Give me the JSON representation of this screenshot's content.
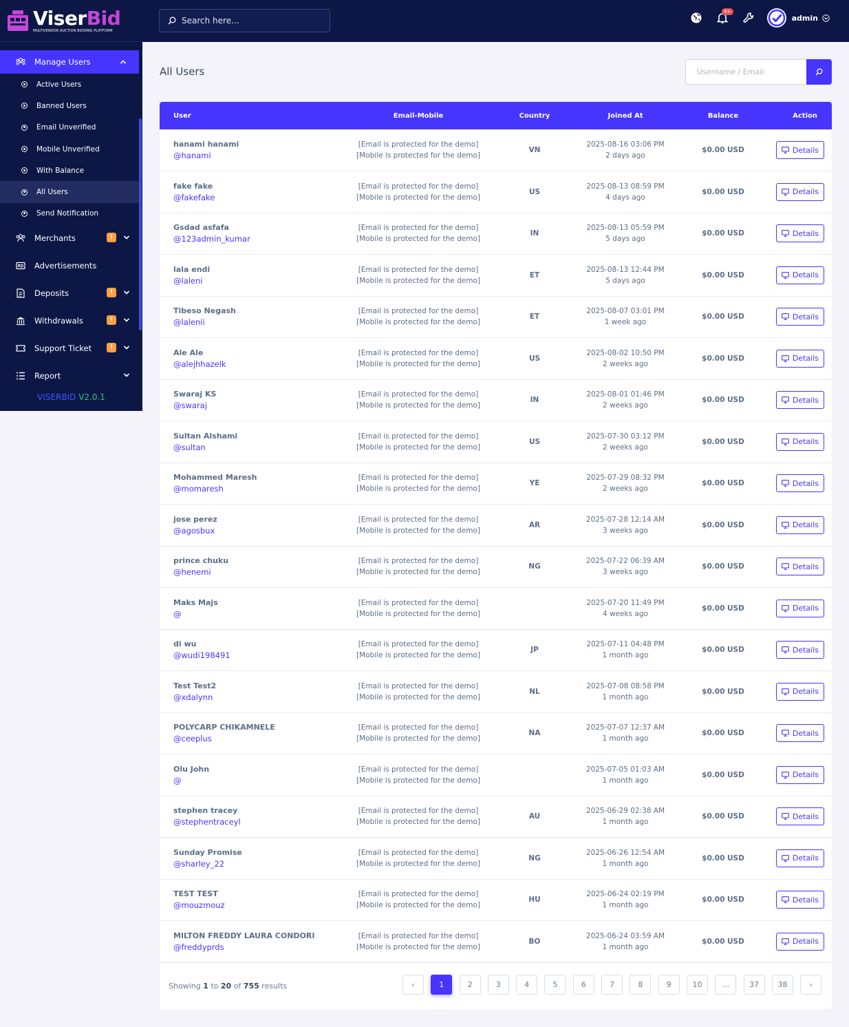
{
  "brand": {
    "name_part1": "Viser",
    "name_part2": "Bid",
    "tagline": "MULTIVENDOR AUCTION BIDDING PLATFORM"
  },
  "sidebar": {
    "manage_users": "Manage Users",
    "sub_items": [
      "Active Users",
      "Banned Users",
      "Email Unverified",
      "Mobile Unverified",
      "With Balance",
      "All Users",
      "Send Notification"
    ],
    "merchants": "Merchants",
    "advertisements": "Advertisements",
    "deposits": "Deposits",
    "withdrawals": "Withdrawals",
    "support_ticket": "Support Ticket",
    "report": "Report",
    "badge": "!",
    "version_name": "VISERBID",
    "version_num": "V2.0.1"
  },
  "topbar": {
    "search_placeholder": "Search here...",
    "notif_count": "9+",
    "admin_name": "admin"
  },
  "page": {
    "title": "All Users",
    "filter_placeholder": "Username / Email"
  },
  "table": {
    "headers": [
      "User",
      "Email-Mobile",
      "Country",
      "Joined At",
      "Balance",
      "Action"
    ],
    "email_text": "[Email is protected for the demo]",
    "mobile_text": "[Mobile is protected for the demo]",
    "details_label": "Details",
    "rows": [
      {
        "name": "hanami hanami",
        "username": "@hanami",
        "country": "VN",
        "date": "2025-08-16 03:06 PM",
        "ago": "2 days ago",
        "balance": "$0.00 USD"
      },
      {
        "name": "fake fake",
        "username": "@fakefake",
        "country": "US",
        "date": "2025-08-13 08:59 PM",
        "ago": "4 days ago",
        "balance": "$0.00 USD"
      },
      {
        "name": "Gsdad asfafa",
        "username": "@123admin_kumar",
        "country": "IN",
        "date": "2025-08-13 05:59 PM",
        "ago": "5 days ago",
        "balance": "$0.00 USD"
      },
      {
        "name": "lala endi",
        "username": "@laleni",
        "country": "ET",
        "date": "2025-08-13 12:44 PM",
        "ago": "5 days ago",
        "balance": "$0.00 USD"
      },
      {
        "name": "Tibeso Negash",
        "username": "@lalenii",
        "country": "ET",
        "date": "2025-08-07 03:01 PM",
        "ago": "1 week ago",
        "balance": "$0.00 USD"
      },
      {
        "name": "Ale Ale",
        "username": "@alejhhazelk",
        "country": "US",
        "date": "2025-08-02 10:50 PM",
        "ago": "2 weeks ago",
        "balance": "$0.00 USD"
      },
      {
        "name": "Swaraj KS",
        "username": "@swaraj",
        "country": "IN",
        "date": "2025-08-01 01:46 PM",
        "ago": "2 weeks ago",
        "balance": "$0.00 USD"
      },
      {
        "name": "Sultan Alshami",
        "username": "@sultan",
        "country": "US",
        "date": "2025-07-30 03:12 PM",
        "ago": "2 weeks ago",
        "balance": "$0.00 USD"
      },
      {
        "name": "Mohammed Maresh",
        "username": "@momaresh",
        "country": "YE",
        "date": "2025-07-29 08:32 PM",
        "ago": "2 weeks ago",
        "balance": "$0.00 USD"
      },
      {
        "name": "jose perez",
        "username": "@agosbux",
        "country": "AR",
        "date": "2025-07-28 12:14 AM",
        "ago": "3 weeks ago",
        "balance": "$0.00 USD"
      },
      {
        "name": "prince chuku",
        "username": "@henemi",
        "country": "NG",
        "date": "2025-07-22 06:39 AM",
        "ago": "3 weeks ago",
        "balance": "$0.00 USD"
      },
      {
        "name": "Maks Majs",
        "username": "@",
        "country": "",
        "date": "2025-07-20 11:49 PM",
        "ago": "4 weeks ago",
        "balance": "$0.00 USD"
      },
      {
        "name": "di wu",
        "username": "@wudi198491",
        "country": "JP",
        "date": "2025-07-11 04:48 PM",
        "ago": "1 month ago",
        "balance": "$0.00 USD"
      },
      {
        "name": "Test Test2",
        "username": "@xdalynn",
        "country": "NL",
        "date": "2025-07-08 08:58 PM",
        "ago": "1 month ago",
        "balance": "$0.00 USD"
      },
      {
        "name": "POLYCARP CHIKAMNELE",
        "username": "@ceeplus",
        "country": "NA",
        "date": "2025-07-07 12:37 AM",
        "ago": "1 month ago",
        "balance": "$0.00 USD"
      },
      {
        "name": "Olu John",
        "username": "@",
        "country": "",
        "date": "2025-07-05 01:03 AM",
        "ago": "1 month ago",
        "balance": "$0.00 USD"
      },
      {
        "name": "stephen tracey",
        "username": "@stephentraceyl",
        "country": "AU",
        "date": "2025-06-29 02:38 AM",
        "ago": "1 month ago",
        "balance": "$0.00 USD"
      },
      {
        "name": "Sunday Promise",
        "username": "@sharley_22",
        "country": "NG",
        "date": "2025-06-26 12:54 AM",
        "ago": "1 month ago",
        "balance": "$0.00 USD"
      },
      {
        "name": "TEST TEST",
        "username": "@mouzmouz",
        "country": "HU",
        "date": "2025-06-24 02:19 PM",
        "ago": "1 month ago",
        "balance": "$0.00 USD"
      },
      {
        "name": "MILTON FREDDY LAURA CONDORI",
        "username": "@freddyprds",
        "country": "BO",
        "date": "2025-06-24 03:59 AM",
        "ago": "1 month ago",
        "balance": "$0.00 USD"
      }
    ]
  },
  "pagination": {
    "showing_prefix": "Showing",
    "from": "1",
    "to_word": "to",
    "to": "20",
    "of_word": "of",
    "total": "755",
    "results_word": "results",
    "prev": "‹",
    "next": "›",
    "pages": [
      "1",
      "2",
      "3",
      "4",
      "5",
      "6",
      "7",
      "8",
      "9",
      "10",
      "...",
      "37",
      "38"
    ],
    "current": "1"
  },
  "colors": {
    "primary": "#4634ff",
    "sidebar": "#0d1746",
    "warning": "#ff9f43"
  }
}
